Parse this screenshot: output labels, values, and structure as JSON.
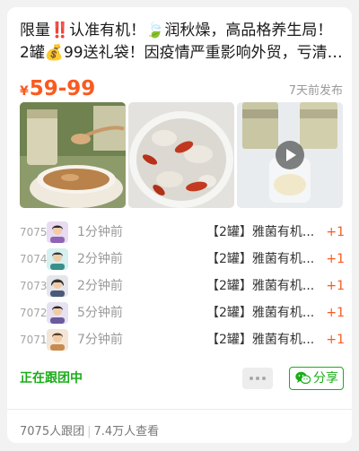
{
  "post": {
    "title": "限量‼️认准有机！🍃润秋燥，高品格养生局！ 2罐💰99送礼袋！因疫情严重影响外贸，亏清回…",
    "price_currency": "¥",
    "price": "59-99",
    "posted": "7天前发布"
  },
  "photos": [
    {
      "icon": "jar-of-snow-fungus-photo"
    },
    {
      "icon": "snow-fungus-soup-with-goji-photo"
    },
    {
      "icon": "snow-fungus-jars-video",
      "is_video": true
    }
  ],
  "orders": [
    {
      "number": "7075",
      "time": "1分钟前",
      "product": "【2罐】雅菌有机...",
      "qty": "+1"
    },
    {
      "number": "7074",
      "time": "2分钟前",
      "product": "【2罐】雅菌有机...",
      "qty": "+1"
    },
    {
      "number": "7073",
      "time": "2分钟前",
      "product": "【2罐】雅菌有机...",
      "qty": "+1"
    },
    {
      "number": "7072",
      "time": "5分钟前",
      "product": "【2罐】雅菌有机...",
      "qty": "+1"
    },
    {
      "number": "7071",
      "time": "7分钟前",
      "product": "【2罐】雅菌有机...",
      "qty": "+1"
    }
  ],
  "actions": {
    "following_label": "正在跟团中",
    "share_label": "分享",
    "more_icon": "more-dots-icon",
    "share_icon": "wechat-icon"
  },
  "stats": {
    "followers": "7075人跟团",
    "views": "7.4万人查看"
  },
  "colors": {
    "accent_price": "#fa5a1f",
    "accent_green": "#1aad19",
    "muted_text": "#9a9a9a"
  }
}
